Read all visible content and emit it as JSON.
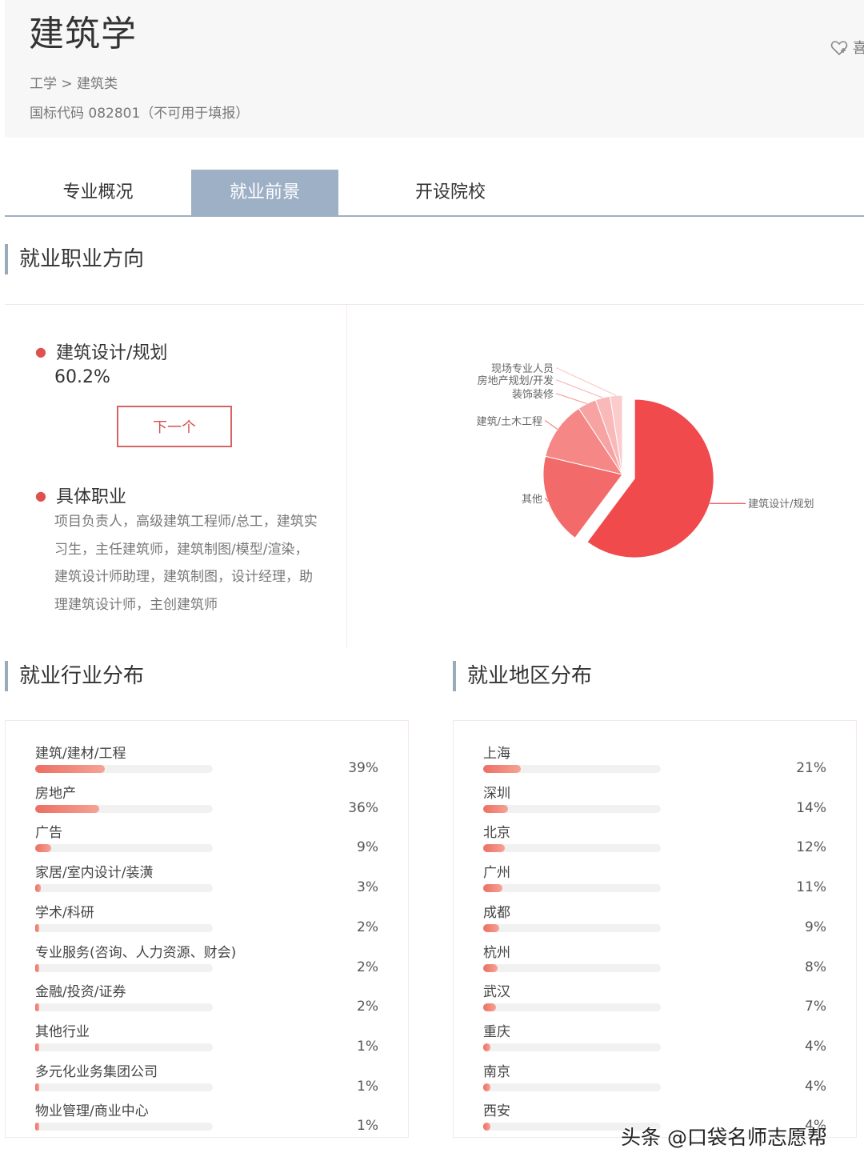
{
  "header": {
    "title": "建筑学",
    "breadcrumb": "工学 > 建筑类",
    "code_line": "国标代码 082801（不可用于填报）",
    "like_label": "喜"
  },
  "tabs": [
    {
      "label": "专业概况",
      "active": false
    },
    {
      "label": "就业前景",
      "active": true
    },
    {
      "label": "开设院校",
      "active": false
    }
  ],
  "career": {
    "heading": "就业职业方向",
    "top_direction": "建筑设计/规划",
    "top_percent": "60.2%",
    "next_button": "下一个",
    "jobs_heading": "具体职业",
    "jobs_text": "项目负责人，高级建筑工程师/总工，建筑实习生，主任建筑师，建筑制图/模型/渲染，建筑设计师助理，建筑制图，设计经理，助理建筑设计师，主创建筑师"
  },
  "chart_data": {
    "type": "pie",
    "slices": [
      {
        "label": "建筑设计/规划",
        "value": 60.2,
        "color": "#f04a4d"
      },
      {
        "label": "其他",
        "value": 18.5,
        "color": "#f26a6a"
      },
      {
        "label": "建筑/土木工程",
        "value": 12.0,
        "color": "#f58787"
      },
      {
        "label": "装饰装修",
        "value": 3.8,
        "color": "#f7a3a3"
      },
      {
        "label": "房地产规划/开发",
        "value": 3.0,
        "color": "#f9b9b9"
      },
      {
        "label": "现场专业人员",
        "value": 2.5,
        "color": "#fbcccc"
      }
    ]
  },
  "industry": {
    "heading": "就业行业分布",
    "items": [
      {
        "label": "建筑/建材/工程",
        "value": "39%",
        "pct": 39
      },
      {
        "label": "房地产",
        "value": "36%",
        "pct": 36
      },
      {
        "label": "广告",
        "value": "9%",
        "pct": 9
      },
      {
        "label": "家居/室内设计/装潢",
        "value": "3%",
        "pct": 3
      },
      {
        "label": "学术/科研",
        "value": "2%",
        "pct": 2
      },
      {
        "label": "专业服务(咨询、人力资源、财会)",
        "value": "2%",
        "pct": 2
      },
      {
        "label": "金融/投资/证券",
        "value": "2%",
        "pct": 2
      },
      {
        "label": "其他行业",
        "value": "1%",
        "pct": 1
      },
      {
        "label": "多元化业务集团公司",
        "value": "1%",
        "pct": 1
      },
      {
        "label": "物业管理/商业中心",
        "value": "1%",
        "pct": 1
      }
    ]
  },
  "region": {
    "heading": "就业地区分布",
    "items": [
      {
        "label": "上海",
        "value": "21%",
        "pct": 21
      },
      {
        "label": "深圳",
        "value": "14%",
        "pct": 14
      },
      {
        "label": "北京",
        "value": "12%",
        "pct": 12
      },
      {
        "label": "广州",
        "value": "11%",
        "pct": 11
      },
      {
        "label": "成都",
        "value": "9%",
        "pct": 9
      },
      {
        "label": "杭州",
        "value": "8%",
        "pct": 8
      },
      {
        "label": "武汉",
        "value": "7%",
        "pct": 7
      },
      {
        "label": "重庆",
        "value": "4%",
        "pct": 4
      },
      {
        "label": "南京",
        "value": "4%",
        "pct": 4
      },
      {
        "label": "西安",
        "value": "4%",
        "pct": 4
      }
    ]
  },
  "watermark": "头条 @口袋名师志愿帮"
}
